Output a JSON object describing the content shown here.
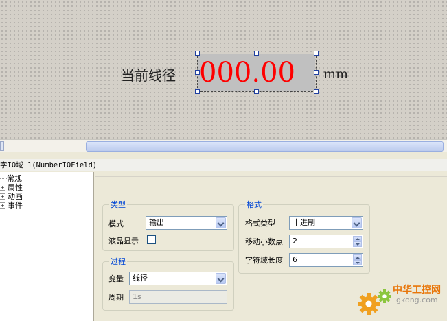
{
  "canvas": {
    "label": "当前线径",
    "io_value": "000.00",
    "unit": "mm"
  },
  "object": {
    "title": "字IO域_1(NumberIOField)"
  },
  "tree": {
    "items": [
      {
        "label": "常规",
        "expander": ""
      },
      {
        "label": "属性",
        "expander": "+"
      },
      {
        "label": "动画",
        "expander": "+"
      },
      {
        "label": "事件",
        "expander": "+"
      }
    ]
  },
  "type_group": {
    "title": "类型",
    "mode_label": "模式",
    "mode_value": "输出",
    "lcd_label": "液晶显示"
  },
  "process_group": {
    "title": "过程",
    "variable_label": "变量",
    "variable_value": "线径",
    "cycle_label": "周期",
    "cycle_value": "1s"
  },
  "format_group": {
    "title": "格式",
    "format_type_label": "格式类型",
    "format_type_value": "十进制",
    "decimal_label": "移动小数点",
    "decimal_value": "2",
    "length_label": "字符域长度",
    "length_value": "6"
  },
  "watermark": {
    "name": "中华工控网",
    "url": "gkong.com"
  },
  "colors": {
    "io_value": "#ff0000",
    "group_title": "#0046d5",
    "watermark": "#e8760a"
  }
}
